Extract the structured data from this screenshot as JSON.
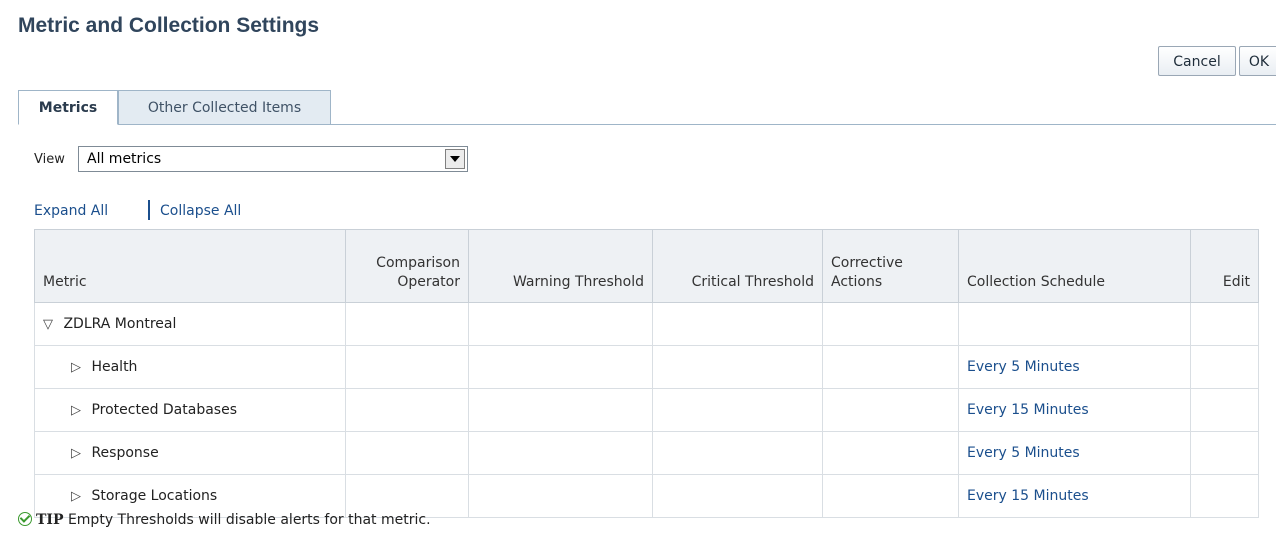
{
  "page": {
    "title": "Metric and Collection Settings"
  },
  "buttons": {
    "cancel": "Cancel",
    "ok": "OK"
  },
  "tabs": [
    {
      "label": "Metrics",
      "selected": true
    },
    {
      "label": "Other Collected Items",
      "selected": false
    }
  ],
  "view": {
    "label": "View",
    "selected": "All metrics"
  },
  "links": {
    "expand_all": "Expand All",
    "collapse_all": "Collapse All"
  },
  "table": {
    "headers": {
      "metric": "Metric",
      "comparison_operator_line1": "Comparison",
      "comparison_operator_line2": "Operator",
      "warning_threshold": "Warning Threshold",
      "critical_threshold": "Critical Threshold",
      "corrective_actions_line1": "Corrective",
      "corrective_actions_line2": "Actions",
      "collection_schedule": "Collection Schedule",
      "edit": "Edit"
    },
    "rows": [
      {
        "metric": "ZDLRA Montreal",
        "expanded": true,
        "level": 0,
        "schedule": ""
      },
      {
        "metric": "Health",
        "expanded": false,
        "level": 1,
        "schedule": "Every 5 Minutes"
      },
      {
        "metric": "Protected Databases",
        "expanded": false,
        "level": 1,
        "schedule": "Every 15 Minutes"
      },
      {
        "metric": "Response",
        "expanded": false,
        "level": 1,
        "schedule": "Every 5 Minutes"
      },
      {
        "metric": "Storage Locations",
        "expanded": false,
        "level": 1,
        "schedule": "Every 15 Minutes"
      }
    ]
  },
  "tip": {
    "label": "TIP",
    "text": "Empty Thresholds will disable alerts for that metric.",
    "icon": "check-circle-icon"
  },
  "colors": {
    "title": "#30455c",
    "link": "#1b4f8d",
    "tab_inactive": "#e3ebf2",
    "tip_icon": "#3b9a2f"
  }
}
